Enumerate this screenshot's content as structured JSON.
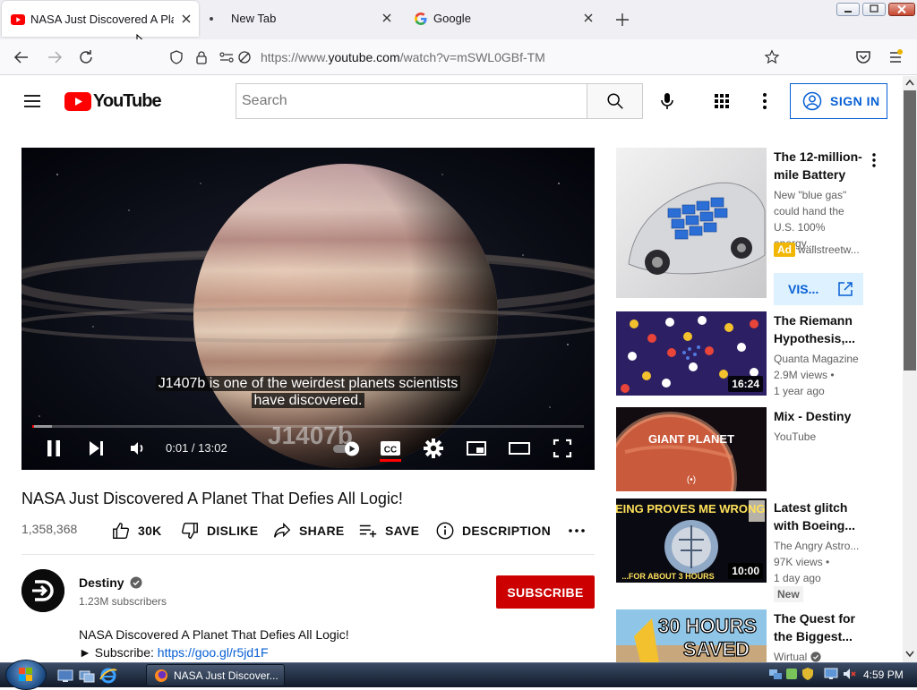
{
  "browser": {
    "tabs": [
      {
        "title": "NASA Just Discovered A Planet That Defies All Logic!",
        "favicon": "youtube-icon",
        "active": true
      },
      {
        "title": "New Tab",
        "favicon": "dot-icon",
        "active": false
      },
      {
        "title": "Google",
        "favicon": "google-icon",
        "active": false
      }
    ],
    "url_prefix": "https://www.",
    "url_domain": "youtube.com",
    "url_path": "/watch?v=mSWL0GBf-TM"
  },
  "youtube": {
    "logo_text": "YouTube",
    "search_placeholder": "Search",
    "sign_in": "SIGN IN",
    "player": {
      "caption_line1": "J1407b is one of the weirdest planets scientists",
      "caption_line2": "have discovered.",
      "watermark": "J1407b",
      "time": "0:01 / 13:02",
      "progress_fraction": 0.0013,
      "loaded_fraction": 0.035
    },
    "video": {
      "title": "NASA Just Discovered A Planet That Defies All Logic!",
      "views": "1,358,368",
      "likes": "30K",
      "dislike": "DISLIKE",
      "share": "SHARE",
      "save": "SAVE",
      "description": "DESCRIPTION"
    },
    "channel": {
      "name": "Destiny",
      "subscribers": "1.23M subscribers",
      "subscribe": "SUBSCRIBE"
    },
    "description_line1": "NASA Discovered A Planet That Defies All Logic!",
    "description_subscribe_prefix": "► Subscribe: ",
    "description_link": "https://goo.gl/r5jd1F",
    "sidebar": {
      "ad": {
        "title": "The 12-million-mile Battery",
        "body": "New \"blue gas\" could hand the U.S. 100% energy...",
        "badge": "Ad",
        "domain": "wallstreetw...",
        "visit": "VIS..."
      },
      "videos": [
        {
          "title": "The Riemann Hypothesis,...",
          "channel": "Quanta Magazine",
          "views": "2.9M views •",
          "age": "1 year ago",
          "duration": "16:24"
        },
        {
          "title": "Mix - Destiny",
          "channel": "YouTube",
          "thumb_text": "GIANT PLANET"
        },
        {
          "title": "Latest glitch with Boeing...",
          "channel": "The Angry Astro...",
          "views": "97K views •",
          "age": "1 day ago",
          "duration": "10:00",
          "badge": "New",
          "thumb_text_top": "BOEING PROVES ME WRONG",
          "thumb_text_bottom": "...FOR ABOUT 3 HOURS"
        },
        {
          "title": "The Quest for the Biggest...",
          "channel": "Wirtual",
          "thumb_text_top": "30 HOURS",
          "thumb_text_bottom": "SAVED"
        }
      ]
    }
  },
  "taskbar": {
    "task_label": "NASA Just Discover...",
    "clock": "4:59 PM"
  },
  "colors": {
    "yt_red": "#ff0000",
    "subscribe_red": "#cc0000",
    "link_blue": "#065fd4"
  }
}
